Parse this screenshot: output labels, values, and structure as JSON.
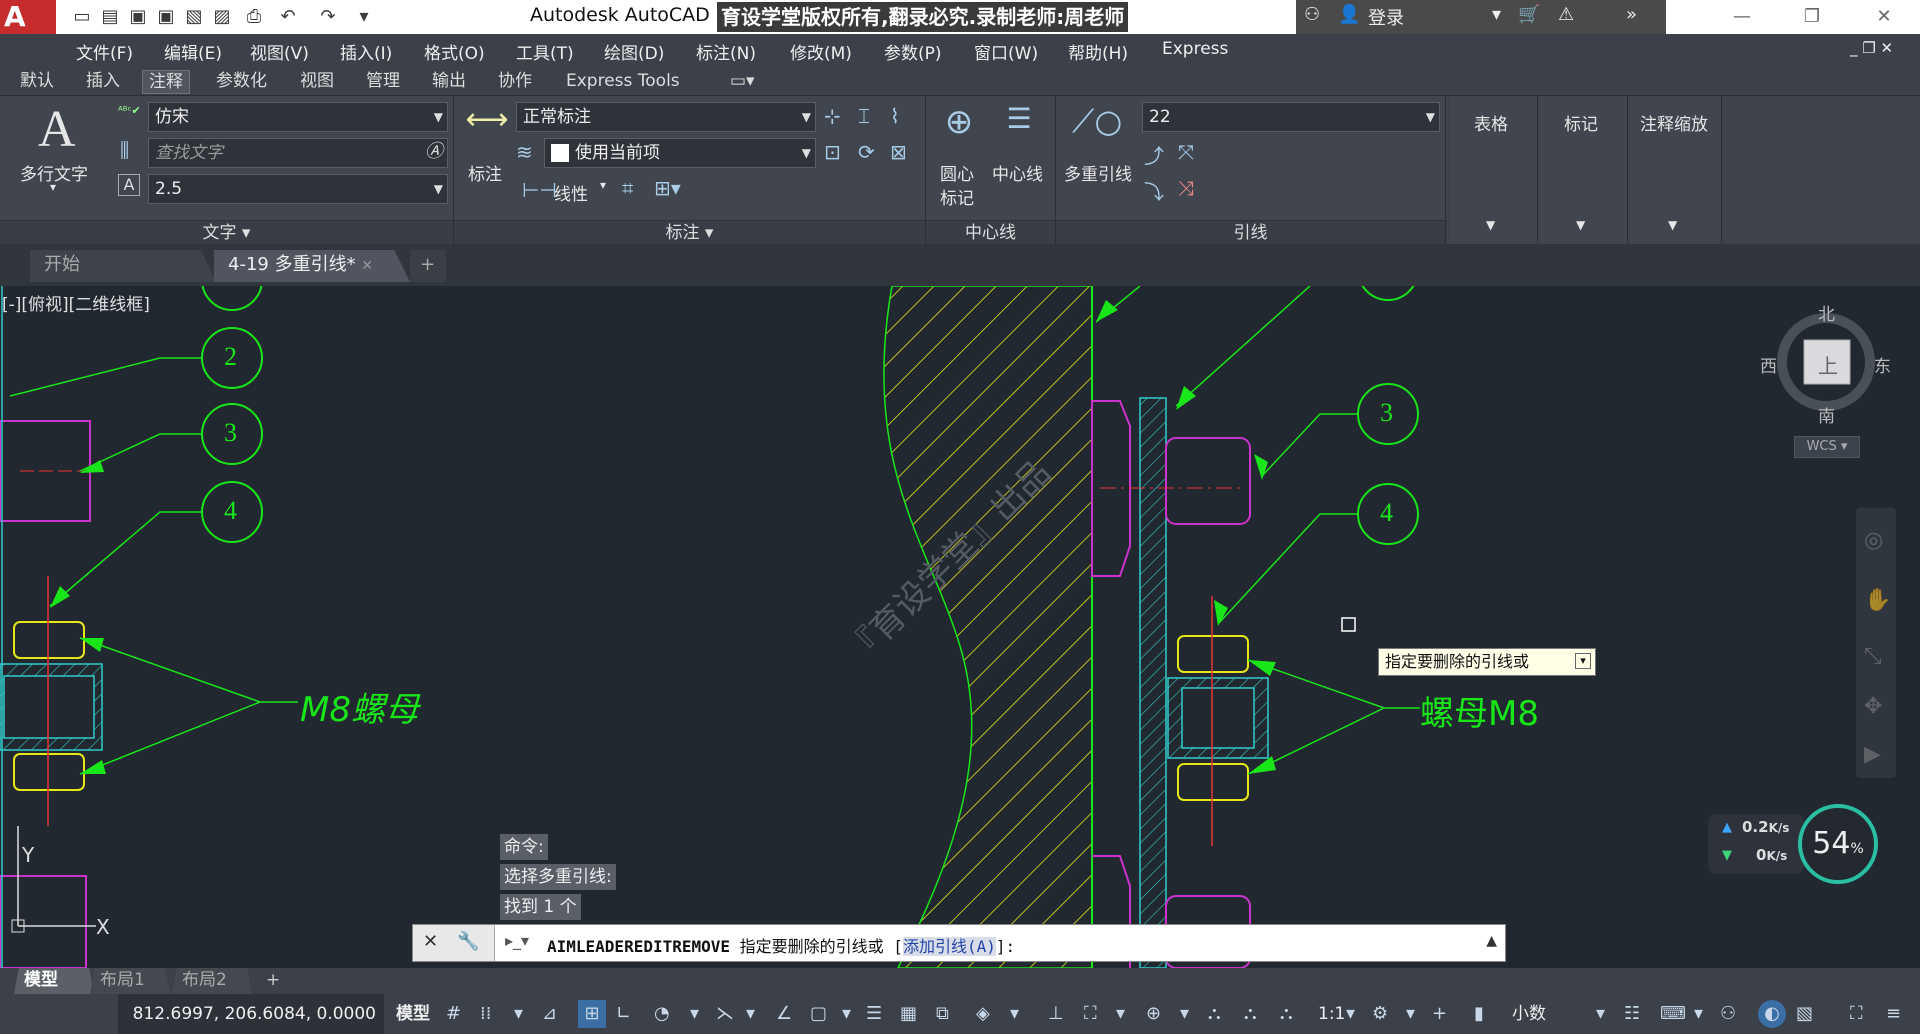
{
  "app": {
    "logo_letter": "A",
    "title": "Autodesk AutoCAD 2",
    "watermark_overlay": "育设学堂版权所有,翻录必究.录制老师:周老师",
    "login": "登录"
  },
  "menu": [
    "文件(F)",
    "编辑(E)",
    "视图(V)",
    "插入(I)",
    "格式(O)",
    "工具(T)",
    "绘图(D)",
    "标注(N)",
    "修改(M)",
    "参数(P)",
    "窗口(W)",
    "帮助(H)",
    "Express"
  ],
  "ribbon_tabs": [
    "默认",
    "插入",
    "注释",
    "参数化",
    "视图",
    "管理",
    "输出",
    "协作",
    "Express Tools"
  ],
  "active_ribbon_tab": "注释",
  "text_panel": {
    "big_button": "多行文字",
    "font_combo": "仿宋",
    "find_placeholder": "查找文字",
    "height_combo": "2.5",
    "footer": "文字"
  },
  "dim_panel": {
    "big_button": "标注",
    "style_combo": "正常标注",
    "layer_combo": "使用当前项",
    "linear": "线性",
    "footer": "标注"
  },
  "centerline_panel": {
    "center_mark": "圆心\n标记",
    "center_mark_l1": "圆心",
    "center_mark_l2": "标记",
    "centerline": "中心线",
    "footer": "中心线"
  },
  "leader_panel": {
    "big_button": "多重引线",
    "style_combo": "22",
    "footer": "引线"
  },
  "extra_panels": [
    "表格",
    "标记",
    "注释缩放"
  ],
  "doc_tabs": [
    "开始",
    "4-19 多重引线*"
  ],
  "viewport_label": "[-][俯视][二维线框]",
  "drawing": {
    "balloons_left": [
      "2",
      "3",
      "4"
    ],
    "balloons_right": [
      "3",
      "4"
    ],
    "label_left": "M8螺母",
    "label_right": "螺母M8",
    "watermark": "『育设学堂』出品"
  },
  "viewcube": {
    "north": "北",
    "south": "南",
    "west": "西",
    "east": "东",
    "face": "上",
    "wcs": "WCS"
  },
  "net_meter": {
    "up": "0.2",
    "down": "0",
    "unit": "K/s",
    "percent": "54",
    "percent_sign": "%"
  },
  "tooltip": "指定要删除的引线或",
  "command_history": [
    "命令:",
    "选择多重引线:",
    "找到 1 个"
  ],
  "command_line": {
    "command": "AIMLEADEREDITREMOVE",
    "prompt": " 指定要删除的引线或 [",
    "option": "添加引线(A)",
    "tail": "]:"
  },
  "layout_tabs": [
    "模型",
    "布局1",
    "布局2"
  ],
  "status": {
    "coords": "812.6997, 206.6084, 0.0000",
    "model": "模型",
    "scale": "1:1",
    "units": "小数"
  },
  "colors": {
    "canvas": "#212830",
    "drawing_green": "#19e619",
    "drawing_magenta": "#cc33cc",
    "drawing_cyan": "#33cccc",
    "drawing_yellow": "#e6e619",
    "center_red": "#e63333"
  }
}
